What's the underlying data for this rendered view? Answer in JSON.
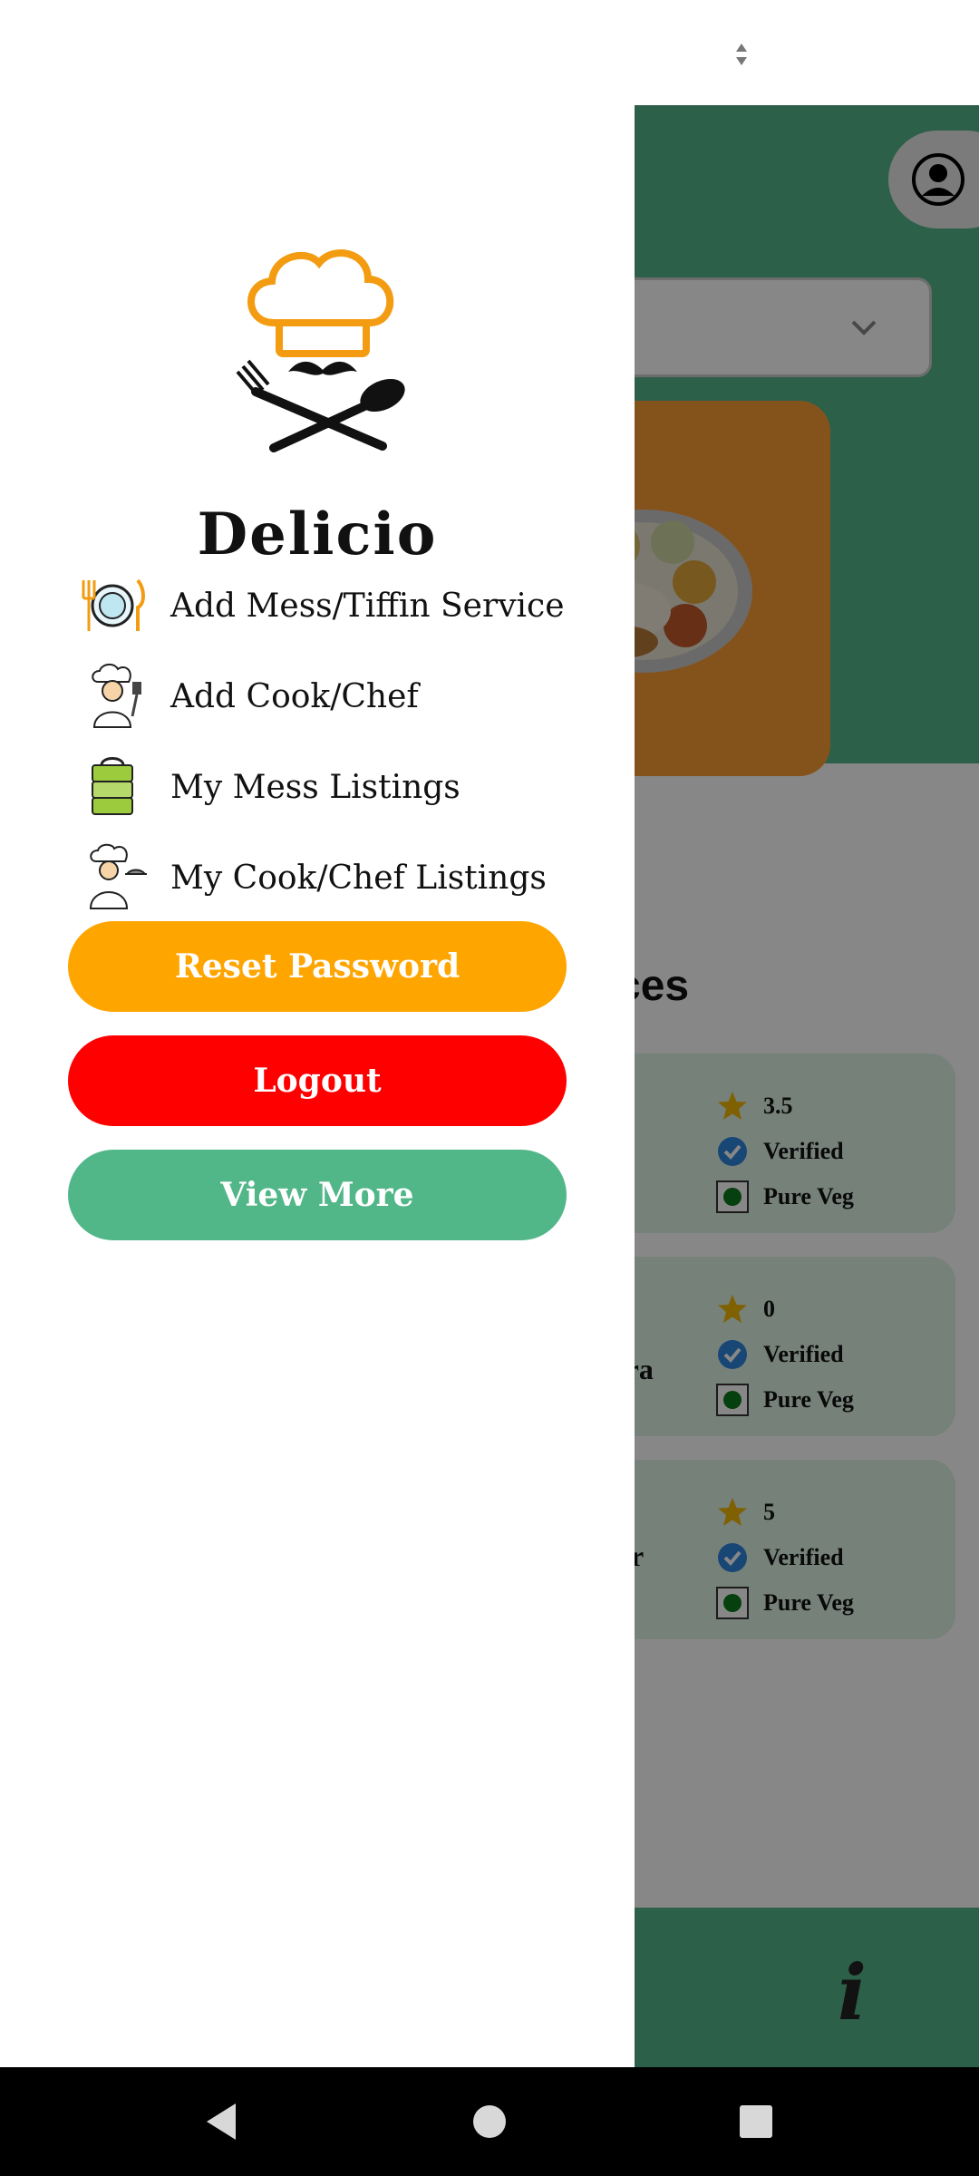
{
  "app": {
    "section_title_fragment": "ces",
    "cards": [
      {
        "side_text": "",
        "rating": "3.5",
        "verified": "Verified",
        "veg": "Pure Veg"
      },
      {
        "side_text": "tra",
        "rating": "0",
        "verified": "Verified",
        "veg": "Pure Veg"
      },
      {
        "side_text": "ar",
        "rating": "5",
        "verified": "Verified",
        "veg": "Pure Veg"
      }
    ]
  },
  "drawer": {
    "brand": "Delicio",
    "menu": [
      {
        "label": "Add Mess/Tiffin Service",
        "icon": "plate-cutlery-icon"
      },
      {
        "label": "Add Cook/Chef",
        "icon": "chef-icon"
      },
      {
        "label": "My Mess Listings",
        "icon": "tiffin-box-icon"
      },
      {
        "label": "My Cook/Chef Listings",
        "icon": "chef-serving-icon"
      }
    ],
    "buttons": {
      "reset": "Reset Password",
      "logout": "Logout",
      "more": "View More"
    }
  },
  "colors": {
    "brand_green": "#55b58a",
    "reset_orange": "#ffa500",
    "logout_red": "#ff0000",
    "view_more_green": "#52b788",
    "logo_orange": "#f39c12"
  }
}
